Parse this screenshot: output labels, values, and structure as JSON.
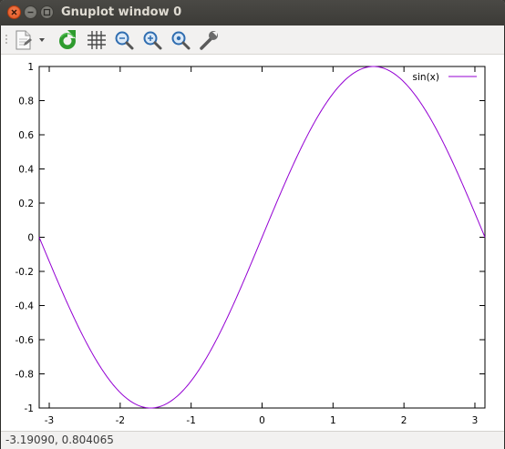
{
  "window": {
    "title": "Gnuplot window 0"
  },
  "toolbar": {
    "items": [
      {
        "name": "copy-to-clipboard-button",
        "icon": "clipboard-export-icon"
      },
      {
        "name": "export-menu-dropdown",
        "icon": "dropdown-arrow-icon"
      },
      {
        "name": "replot-button",
        "icon": "refresh-icon"
      },
      {
        "name": "toggle-grid-button",
        "icon": "grid-icon"
      },
      {
        "name": "previous-zoom-button",
        "icon": "zoom-previous-icon"
      },
      {
        "name": "next-zoom-button",
        "icon": "zoom-next-icon"
      },
      {
        "name": "autoscale-button",
        "icon": "zoom-autoscale-icon"
      },
      {
        "name": "settings-button",
        "icon": "wrench-icon"
      }
    ]
  },
  "status": {
    "mouse_coords": "-3.19090,  0.804065"
  },
  "colors": {
    "series": "#9400d3",
    "titlebar": "#3c3b37",
    "close_button": "#e95420"
  },
  "chart_data": {
    "type": "line",
    "function": "sin(x)",
    "xlim": [
      -3.14159,
      3.14159
    ],
    "ylim": [
      -1,
      1
    ],
    "xticks": [
      "-3",
      "-2",
      "-1",
      "0",
      "1",
      "2",
      "3"
    ],
    "yticks": [
      "-1",
      "-0.8",
      "-0.6",
      "-0.4",
      "-0.2",
      "0",
      "0.2",
      "0.4",
      "0.6",
      "0.8",
      "1"
    ],
    "xtick_values": [
      -3,
      -2,
      -1,
      0,
      1,
      2,
      3
    ],
    "ytick_values": [
      -1,
      -0.8,
      -0.6,
      -0.4,
      -0.2,
      0,
      0.2,
      0.4,
      0.6,
      0.8,
      1
    ],
    "series": [
      {
        "name": "sin(x)",
        "color": "#9400d3",
        "x": [
          -3.14159,
          -2.74889,
          -2.35619,
          -1.9635,
          -1.5708,
          -1.1781,
          -0.7854,
          -0.3927,
          0,
          0.3927,
          0.7854,
          1.1781,
          1.5708,
          1.9635,
          2.35619,
          2.74889,
          3.14159
        ],
        "y": [
          0,
          -0.38268,
          -0.70711,
          -0.92388,
          -1,
          -0.92388,
          -0.70711,
          -0.38268,
          0,
          0.38268,
          0.70711,
          0.92388,
          1,
          0.92388,
          0.70711,
          0.38268,
          0
        ]
      }
    ],
    "legend": "top-right",
    "grid": false
  }
}
